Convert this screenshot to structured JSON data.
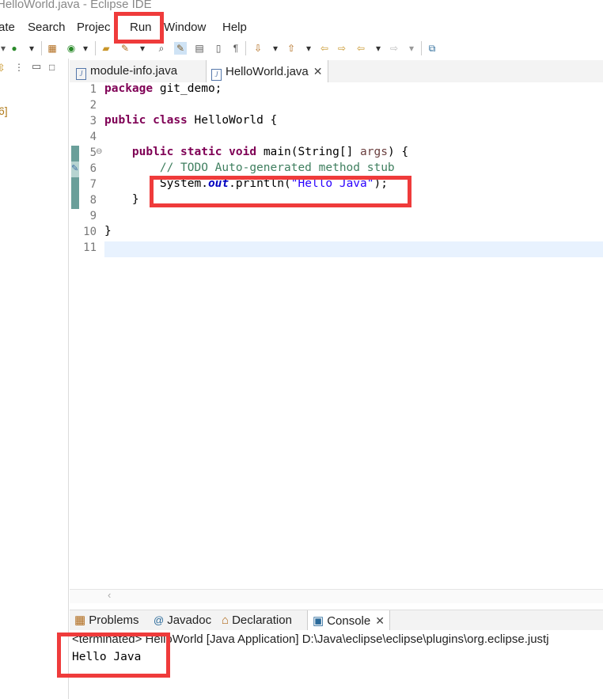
{
  "window": {
    "title": "HelloWorld.java - Eclipse IDE"
  },
  "menubar": {
    "items": [
      "ate",
      "Search",
      "Projec",
      "Run",
      "Window",
      "Help"
    ]
  },
  "editor": {
    "tabs": [
      {
        "label": "module-info.java",
        "active": false
      },
      {
        "label": "HelloWorld.java",
        "active": true
      }
    ],
    "lines": [
      {
        "num": "1",
        "tokens": [
          [
            "kw",
            "package"
          ],
          [
            "t",
            " git_demo;"
          ]
        ]
      },
      {
        "num": "2",
        "tokens": []
      },
      {
        "num": "3",
        "tokens": [
          [
            "kw",
            "public"
          ],
          [
            "t",
            " "
          ],
          [
            "kw",
            "class"
          ],
          [
            "t",
            " HelloWorld {"
          ]
        ]
      },
      {
        "num": "4",
        "tokens": []
      },
      {
        "num": "5",
        "fold": "⊖",
        "tokens": [
          [
            "t",
            "    "
          ],
          [
            "kw",
            "public"
          ],
          [
            "t",
            " "
          ],
          [
            "kw",
            "static"
          ],
          [
            "t",
            " "
          ],
          [
            "kw",
            "void"
          ],
          [
            "t",
            " main(String[] "
          ],
          [
            "prm",
            "args"
          ],
          [
            "t",
            ") {"
          ]
        ]
      },
      {
        "num": "6",
        "tokens": [
          [
            "t",
            "        "
          ],
          [
            "cmt",
            "// TODO Auto-generated method stub"
          ]
        ]
      },
      {
        "num": "7",
        "tokens": [
          [
            "t",
            "        System."
          ],
          [
            "fld",
            "out"
          ],
          [
            "t",
            ".println("
          ],
          [
            "str",
            "\"Hello Java\""
          ],
          [
            "t",
            ");"
          ]
        ]
      },
      {
        "num": "8",
        "tokens": [
          [
            "t",
            "    }"
          ]
        ]
      },
      {
        "num": "9",
        "tokens": []
      },
      {
        "num": "10",
        "tokens": [
          [
            "t",
            "}"
          ]
        ]
      },
      {
        "num": "11",
        "tokens": []
      }
    ]
  },
  "left_panel": {
    "marker": "6]"
  },
  "console": {
    "tabs": [
      {
        "label": "Problems",
        "icon": "problems-icon"
      },
      {
        "label": "Javadoc",
        "icon": "at-icon"
      },
      {
        "label": "Declaration",
        "icon": "declaration-icon"
      },
      {
        "label": "Console",
        "icon": "console-icon",
        "active": true
      }
    ],
    "status": "<terminated> HelloWorld [Java Application] D:\\Java\\eclipse\\eclipse\\plugins\\org.eclipse.justj",
    "output": "Hello Java"
  },
  "colors": {
    "highlight": "#ef3b3b",
    "keyword": "#7f0055",
    "string": "#2a00ff",
    "current_line": "#e8f2fe"
  }
}
